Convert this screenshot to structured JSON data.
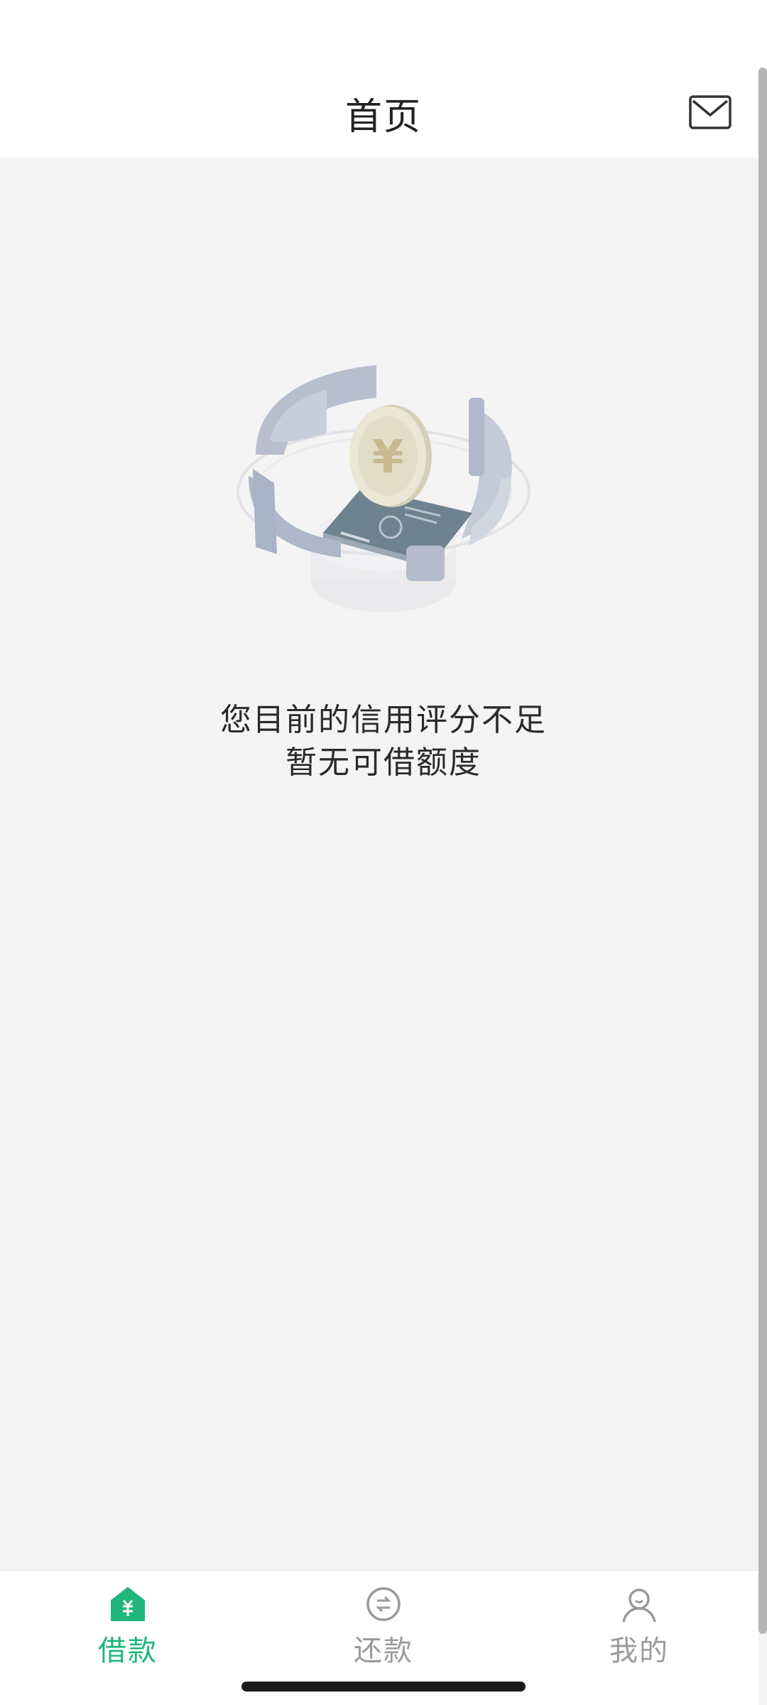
{
  "header": {
    "title": "首页",
    "mail_icon": "mail-icon"
  },
  "empty_state": {
    "illustration": "credit-coin-illustration",
    "line1": "您目前的信用评分不足",
    "line2": "暂无可借额度"
  },
  "tabbar": {
    "tabs": [
      {
        "label": "借款",
        "icon": "home-yen-icon",
        "active": true
      },
      {
        "label": "还款",
        "icon": "repay-circle-icon",
        "active": false
      },
      {
        "label": "我的",
        "icon": "user-icon",
        "active": false
      }
    ]
  },
  "colors": {
    "accent": "#1fb57b",
    "background": "#f4f4f4",
    "inactive": "#9a9a9a"
  }
}
